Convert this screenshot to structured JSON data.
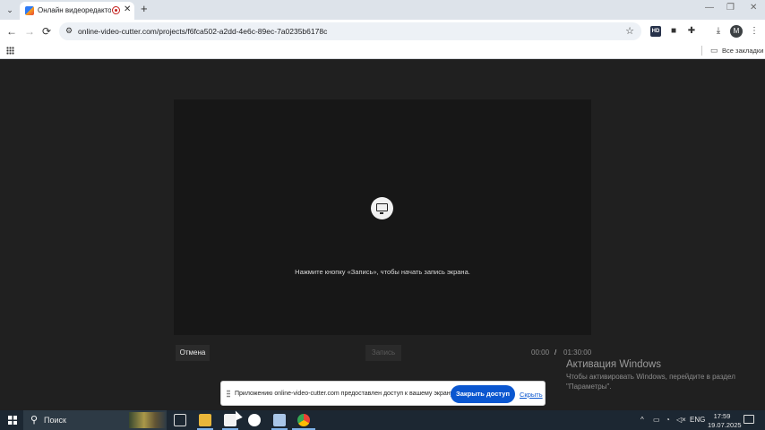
{
  "browser": {
    "tab": {
      "title": "Онлайн видеоредактор – Cl",
      "close_glyph": "✕"
    },
    "tab_list_glyph": "⌄",
    "new_tab_glyph": "+",
    "window_controls": {
      "minimize": "—",
      "restore": "❐",
      "close": "✕"
    },
    "nav": {
      "back": "←",
      "forward": "→",
      "reload": "⟳"
    },
    "url": "online-video-cutter.com/projects/f6fca502-a2dd-4e6c-89ec-7a0235b6178c",
    "profile_initial": "M",
    "bookmarks_bar": {
      "all_bookmarks": "Все закладки"
    }
  },
  "page": {
    "hint": "Нажмите кнопку «Запись», чтобы начать запись экрана.",
    "cancel_label": "Отмена",
    "record_label": "Запись",
    "time_current": "00:00",
    "time_separator": "/",
    "time_total": "01:30:00"
  },
  "windows_watermark": {
    "title": "Активация Windows",
    "text": "Чтобы активировать Windows, перейдите в раздел \"Параметры\"."
  },
  "share_bar": {
    "message": "Приложению online-video-cutter.com предоставлен доступ к вашему экрану.",
    "stop_label": "Закрыть доступ",
    "hide_label": "Скрыть"
  },
  "taskbar": {
    "search_label": "Поиск",
    "language": "ENG",
    "time": "17:59",
    "date": "19.07.2025"
  }
}
